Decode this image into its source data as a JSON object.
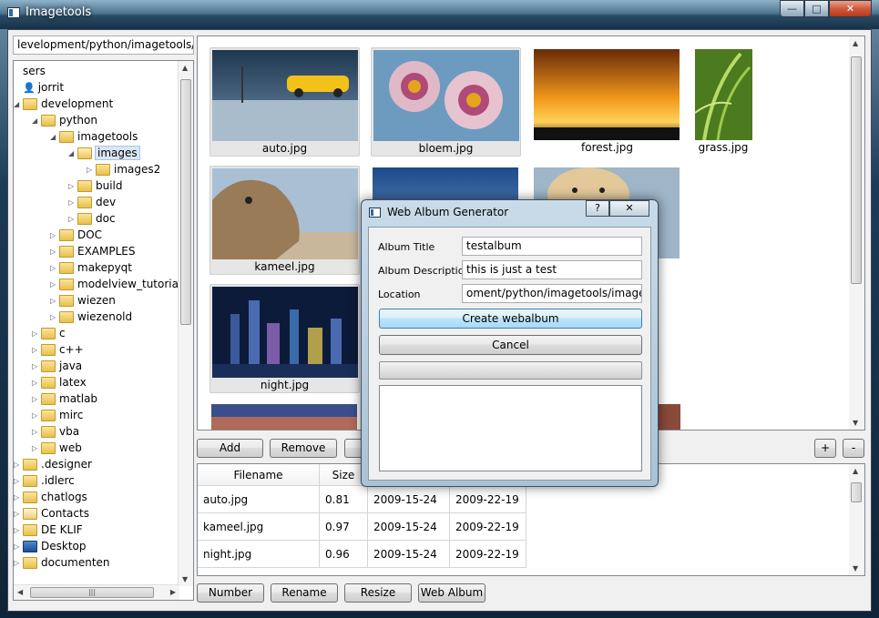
{
  "window": {
    "title": "Imagetools",
    "minimize_icon": "—",
    "maximize_icon": "□",
    "close_icon": "✕"
  },
  "path_bar": {
    "value": "levelopment/python/imagetools/images"
  },
  "tree": {
    "items": [
      {
        "label": "sers",
        "depth": 0,
        "icon": "none",
        "expander": ""
      },
      {
        "label": "jorrit",
        "depth": 0,
        "icon": "user-icon",
        "expander": ""
      },
      {
        "label": "development",
        "depth": 0,
        "icon": "folder-icon",
        "expander": "◢"
      },
      {
        "label": "python",
        "depth": 1,
        "icon": "folder-icon",
        "expander": "◢"
      },
      {
        "label": "imagetools",
        "depth": 2,
        "icon": "python-folder-icon",
        "expander": "◢"
      },
      {
        "label": "images",
        "depth": 3,
        "icon": "folder-open-icon",
        "expander": "◢",
        "selected": true
      },
      {
        "label": "images2",
        "depth": 4,
        "icon": "folder-icon",
        "expander": "▷"
      },
      {
        "label": "build",
        "depth": 3,
        "icon": "folder-icon",
        "expander": "▷"
      },
      {
        "label": "dev",
        "depth": 3,
        "icon": "folder-icon",
        "expander": "▷"
      },
      {
        "label": "doc",
        "depth": 3,
        "icon": "folder-icon",
        "expander": "▷"
      },
      {
        "label": "DOC",
        "depth": 2,
        "icon": "folder-icon",
        "expander": "▷"
      },
      {
        "label": "EXAMPLES",
        "depth": 2,
        "icon": "folder-icon",
        "expander": "▷"
      },
      {
        "label": "makepyqt",
        "depth": 2,
        "icon": "folder-icon",
        "expander": "▷"
      },
      {
        "label": "modelview_tutorial",
        "depth": 2,
        "icon": "folder-icon",
        "expander": "▷"
      },
      {
        "label": "wiezen",
        "depth": 2,
        "icon": "folder-icon",
        "expander": "▷"
      },
      {
        "label": "wiezenold",
        "depth": 2,
        "icon": "folder-icon",
        "expander": "▷"
      },
      {
        "label": "c",
        "depth": 1,
        "icon": "folder-icon",
        "expander": "▷"
      },
      {
        "label": "c++",
        "depth": 1,
        "icon": "folder-icon",
        "expander": "▷"
      },
      {
        "label": "java",
        "depth": 1,
        "icon": "folder-icon",
        "expander": "▷"
      },
      {
        "label": "latex",
        "depth": 1,
        "icon": "folder-icon",
        "expander": "▷"
      },
      {
        "label": "matlab",
        "depth": 1,
        "icon": "folder-icon",
        "expander": "▷"
      },
      {
        "label": "mirc",
        "depth": 1,
        "icon": "folder-icon",
        "expander": "▷"
      },
      {
        "label": "vba",
        "depth": 1,
        "icon": "folder-icon",
        "expander": "▷"
      },
      {
        "label": "web",
        "depth": 1,
        "icon": "folder-icon",
        "expander": "▷"
      },
      {
        "label": ".designer",
        "depth": 0,
        "icon": "folder-icon",
        "expander": "▷"
      },
      {
        "label": ".idlerc",
        "depth": 0,
        "icon": "folder-icon",
        "expander": "▷"
      },
      {
        "label": "chatlogs",
        "depth": 0,
        "icon": "folder-icon",
        "expander": "▷"
      },
      {
        "label": "Contacts",
        "depth": 0,
        "icon": "contacts-icon",
        "expander": "▷"
      },
      {
        "label": "DE KLIF",
        "depth": 0,
        "icon": "folder-icon",
        "expander": "▷"
      },
      {
        "label": "Desktop",
        "depth": 0,
        "icon": "desktop-icon",
        "expander": "▷"
      },
      {
        "label": "documenten",
        "depth": 0,
        "icon": "folder-icon",
        "expander": "▷"
      }
    ]
  },
  "thumbnails": [
    {
      "caption": "auto.jpg",
      "boxed": true
    },
    {
      "caption": "bloem.jpg",
      "boxed": true
    },
    {
      "caption": "forest.jpg",
      "boxed": false
    },
    {
      "caption": "grass.jpg",
      "boxed": false
    },
    {
      "caption": "kameel.jpg",
      "boxed": true
    },
    {
      "caption": "night.jpg",
      "boxed": true
    }
  ],
  "grid_buttons": {
    "add": "Add",
    "remove": "Remove",
    "zoom_in": "+",
    "zoom_out": "-"
  },
  "table": {
    "columns": [
      "Filename",
      "Size",
      "",
      ""
    ],
    "rows": [
      [
        "auto.jpg",
        "0.81",
        "2009-15-24",
        "2009-22-19"
      ],
      [
        "kameel.jpg",
        "0.97",
        "2009-15-24",
        "2009-22-19"
      ],
      [
        "night.jpg",
        "0.96",
        "2009-15-24",
        "2009-22-19"
      ]
    ]
  },
  "bottom_buttons": {
    "number": "Number",
    "rename": "Rename",
    "resize": "Resize",
    "web_album": "Web Album"
  },
  "dialog": {
    "title": "Web Album Generator",
    "help_icon": "?",
    "close_icon": "✕",
    "album_title_label": "Album Title",
    "album_title_value": "testalbum",
    "album_description_label": "Album Description",
    "album_description_value": "this is just a test",
    "location_label": "Location",
    "location_value": "oment/python/imagetools/images/images",
    "create_button": "Create webalbum",
    "cancel_button": "Cancel",
    "progress": 0
  },
  "colors": {
    "selection": "#dbe6f4",
    "dialog_frame": "#a9c2d6",
    "default_button": "#bee6fd"
  }
}
